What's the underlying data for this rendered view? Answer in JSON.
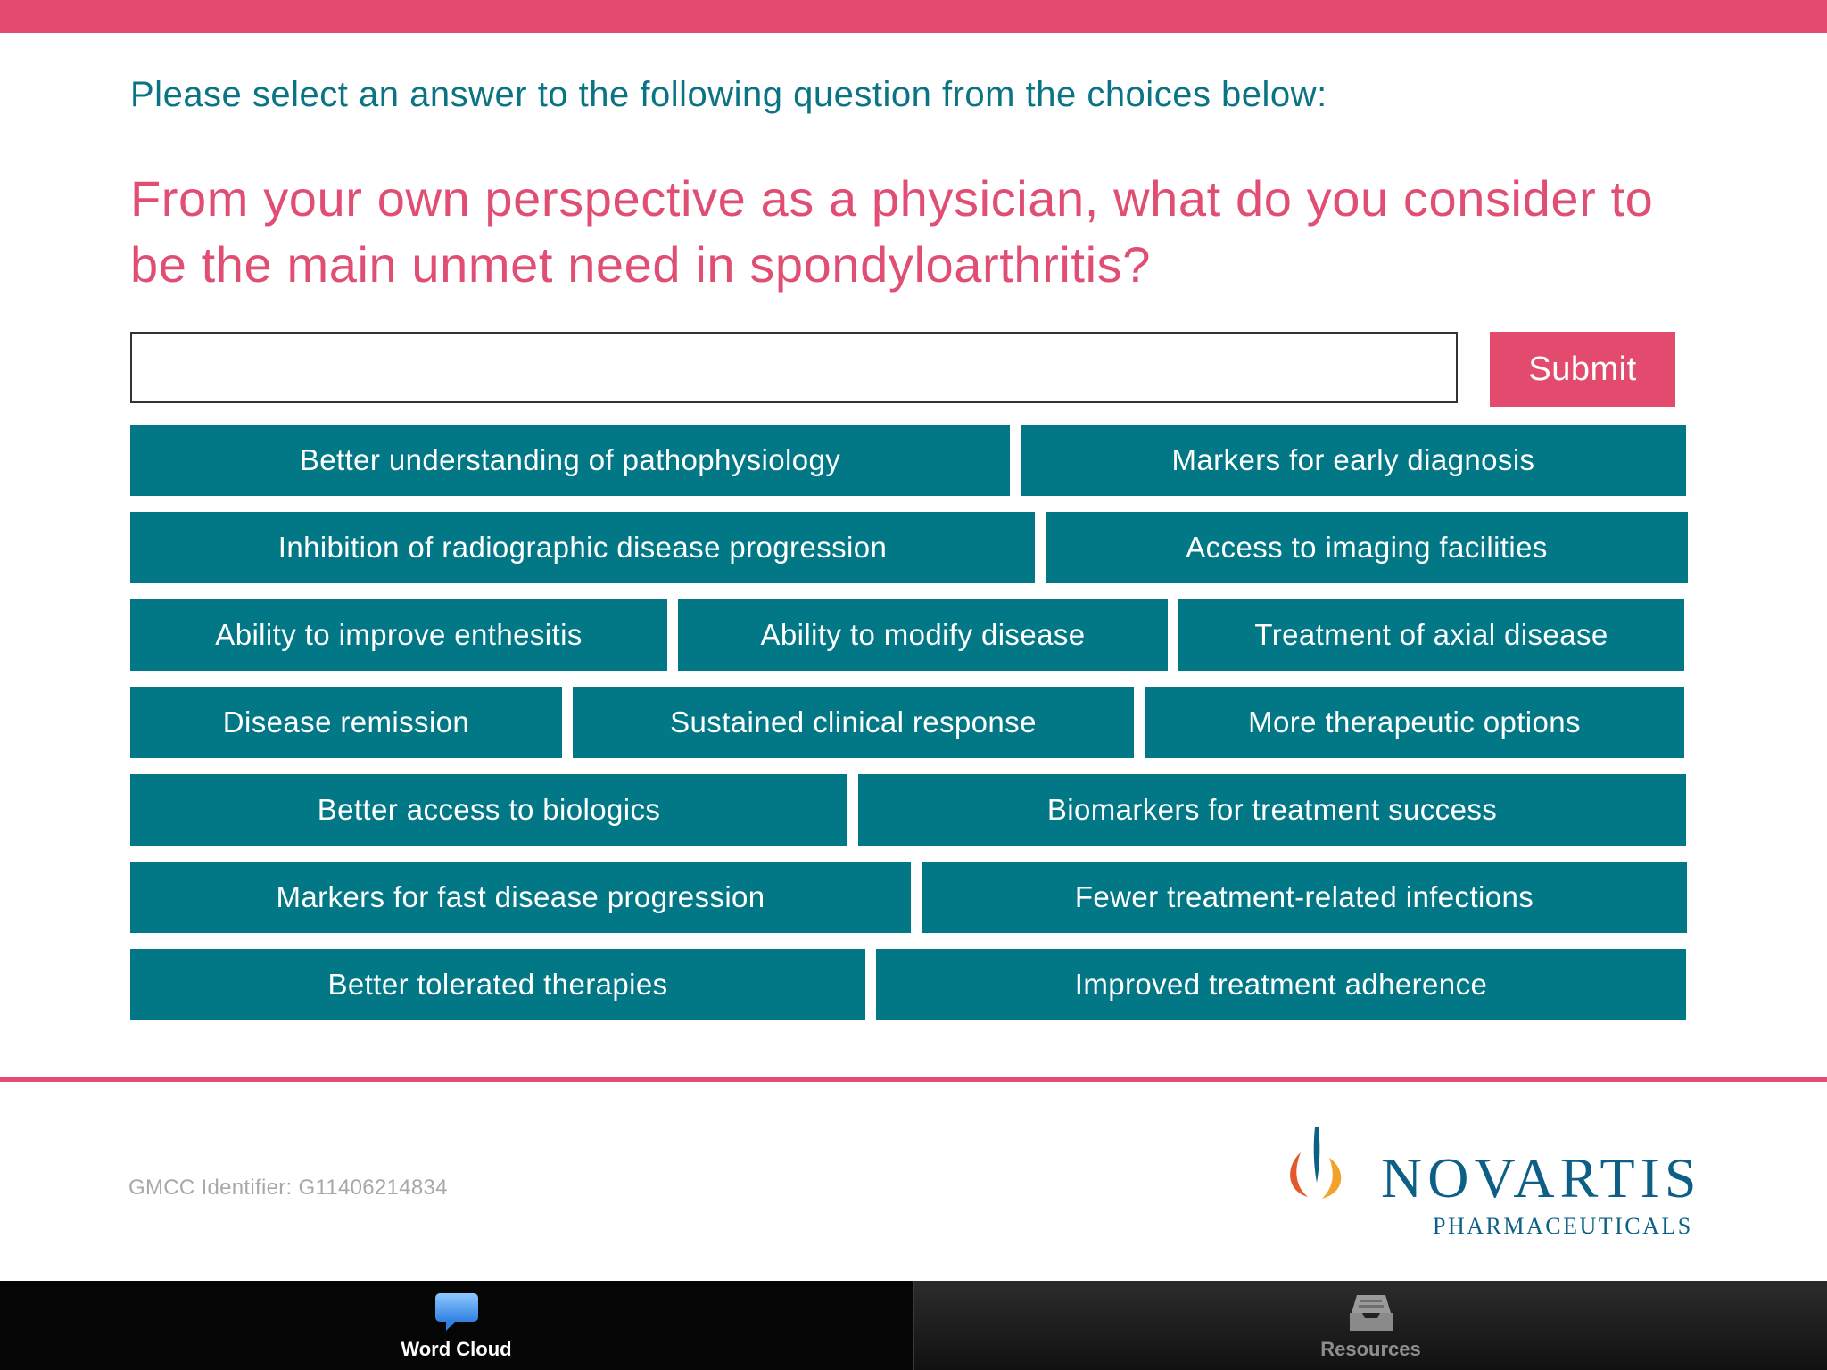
{
  "header": {
    "instruction": "Please select an answer to the following question from the choices below:",
    "question": "From your own perspective as a physician, what do you consider to be the main unmet need in spondyloarthritis?"
  },
  "answer_field": {
    "value": "",
    "placeholder": ""
  },
  "submit_label": "Submit",
  "choices": [
    [
      "Better understanding of pathophysiology",
      "Markers for early diagnosis"
    ],
    [
      "Inhibition of radiographic disease progression",
      "Access to imaging facilities"
    ],
    [
      "Ability to improve enthesitis",
      "Ability to modify disease",
      "Treatment of axial disease"
    ],
    [
      "Disease remission",
      "Sustained clinical response",
      "More therapeutic options"
    ],
    [
      "Better access to biologics",
      "Biomarkers for treatment success"
    ],
    [
      "Markers for fast disease progression",
      "Fewer treatment-related infections"
    ],
    [
      "Better tolerated therapies",
      "Improved treatment adherence"
    ]
  ],
  "footer": {
    "identifier": "GMCC Identifier: G11406214834",
    "brand_name": "NOVARTIS",
    "brand_sub": "PHARMACEUTICALS"
  },
  "tabs": [
    {
      "label": "Word Cloud",
      "icon": "speech-bubble-icon",
      "active": true
    },
    {
      "label": "Resources",
      "icon": "inbox-tray-icon",
      "active": false
    }
  ],
  "colors": {
    "accent_pink": "#e34b6e",
    "teal": "#027786",
    "instruction_teal": "#0b7484",
    "brand_blue": "#0d5f86"
  }
}
